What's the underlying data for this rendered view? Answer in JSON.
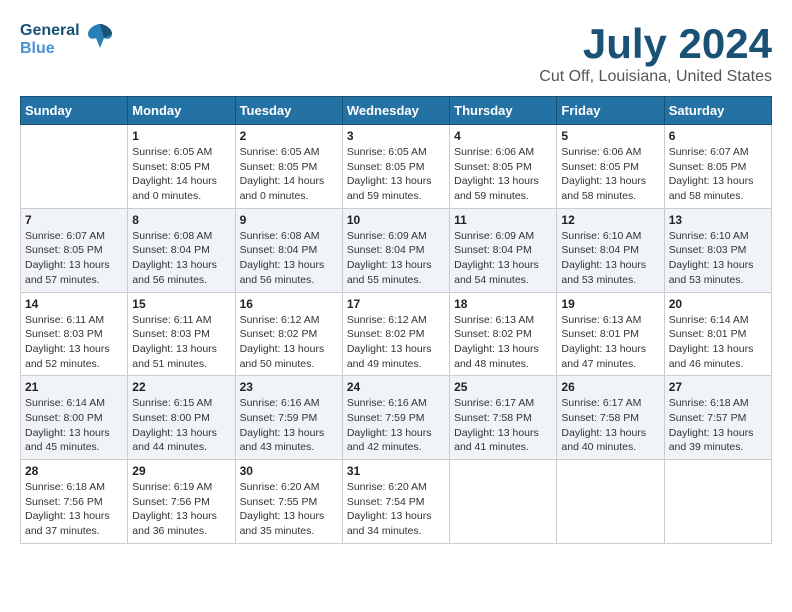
{
  "header": {
    "logo_line1": "General",
    "logo_line2": "Blue",
    "title": "July 2024",
    "location": "Cut Off, Louisiana, United States"
  },
  "weekdays": [
    "Sunday",
    "Monday",
    "Tuesday",
    "Wednesday",
    "Thursday",
    "Friday",
    "Saturday"
  ],
  "weeks": [
    [
      {
        "day": "",
        "info": ""
      },
      {
        "day": "1",
        "info": "Sunrise: 6:05 AM\nSunset: 8:05 PM\nDaylight: 14 hours\nand 0 minutes."
      },
      {
        "day": "2",
        "info": "Sunrise: 6:05 AM\nSunset: 8:05 PM\nDaylight: 14 hours\nand 0 minutes."
      },
      {
        "day": "3",
        "info": "Sunrise: 6:05 AM\nSunset: 8:05 PM\nDaylight: 13 hours\nand 59 minutes."
      },
      {
        "day": "4",
        "info": "Sunrise: 6:06 AM\nSunset: 8:05 PM\nDaylight: 13 hours\nand 59 minutes."
      },
      {
        "day": "5",
        "info": "Sunrise: 6:06 AM\nSunset: 8:05 PM\nDaylight: 13 hours\nand 58 minutes."
      },
      {
        "day": "6",
        "info": "Sunrise: 6:07 AM\nSunset: 8:05 PM\nDaylight: 13 hours\nand 58 minutes."
      }
    ],
    [
      {
        "day": "7",
        "info": "Sunrise: 6:07 AM\nSunset: 8:05 PM\nDaylight: 13 hours\nand 57 minutes."
      },
      {
        "day": "8",
        "info": "Sunrise: 6:08 AM\nSunset: 8:04 PM\nDaylight: 13 hours\nand 56 minutes."
      },
      {
        "day": "9",
        "info": "Sunrise: 6:08 AM\nSunset: 8:04 PM\nDaylight: 13 hours\nand 56 minutes."
      },
      {
        "day": "10",
        "info": "Sunrise: 6:09 AM\nSunset: 8:04 PM\nDaylight: 13 hours\nand 55 minutes."
      },
      {
        "day": "11",
        "info": "Sunrise: 6:09 AM\nSunset: 8:04 PM\nDaylight: 13 hours\nand 54 minutes."
      },
      {
        "day": "12",
        "info": "Sunrise: 6:10 AM\nSunset: 8:04 PM\nDaylight: 13 hours\nand 53 minutes."
      },
      {
        "day": "13",
        "info": "Sunrise: 6:10 AM\nSunset: 8:03 PM\nDaylight: 13 hours\nand 53 minutes."
      }
    ],
    [
      {
        "day": "14",
        "info": "Sunrise: 6:11 AM\nSunset: 8:03 PM\nDaylight: 13 hours\nand 52 minutes."
      },
      {
        "day": "15",
        "info": "Sunrise: 6:11 AM\nSunset: 8:03 PM\nDaylight: 13 hours\nand 51 minutes."
      },
      {
        "day": "16",
        "info": "Sunrise: 6:12 AM\nSunset: 8:02 PM\nDaylight: 13 hours\nand 50 minutes."
      },
      {
        "day": "17",
        "info": "Sunrise: 6:12 AM\nSunset: 8:02 PM\nDaylight: 13 hours\nand 49 minutes."
      },
      {
        "day": "18",
        "info": "Sunrise: 6:13 AM\nSunset: 8:02 PM\nDaylight: 13 hours\nand 48 minutes."
      },
      {
        "day": "19",
        "info": "Sunrise: 6:13 AM\nSunset: 8:01 PM\nDaylight: 13 hours\nand 47 minutes."
      },
      {
        "day": "20",
        "info": "Sunrise: 6:14 AM\nSunset: 8:01 PM\nDaylight: 13 hours\nand 46 minutes."
      }
    ],
    [
      {
        "day": "21",
        "info": "Sunrise: 6:14 AM\nSunset: 8:00 PM\nDaylight: 13 hours\nand 45 minutes."
      },
      {
        "day": "22",
        "info": "Sunrise: 6:15 AM\nSunset: 8:00 PM\nDaylight: 13 hours\nand 44 minutes."
      },
      {
        "day": "23",
        "info": "Sunrise: 6:16 AM\nSunset: 7:59 PM\nDaylight: 13 hours\nand 43 minutes."
      },
      {
        "day": "24",
        "info": "Sunrise: 6:16 AM\nSunset: 7:59 PM\nDaylight: 13 hours\nand 42 minutes."
      },
      {
        "day": "25",
        "info": "Sunrise: 6:17 AM\nSunset: 7:58 PM\nDaylight: 13 hours\nand 41 minutes."
      },
      {
        "day": "26",
        "info": "Sunrise: 6:17 AM\nSunset: 7:58 PM\nDaylight: 13 hours\nand 40 minutes."
      },
      {
        "day": "27",
        "info": "Sunrise: 6:18 AM\nSunset: 7:57 PM\nDaylight: 13 hours\nand 39 minutes."
      }
    ],
    [
      {
        "day": "28",
        "info": "Sunrise: 6:18 AM\nSunset: 7:56 PM\nDaylight: 13 hours\nand 37 minutes."
      },
      {
        "day": "29",
        "info": "Sunrise: 6:19 AM\nSunset: 7:56 PM\nDaylight: 13 hours\nand 36 minutes."
      },
      {
        "day": "30",
        "info": "Sunrise: 6:20 AM\nSunset: 7:55 PM\nDaylight: 13 hours\nand 35 minutes."
      },
      {
        "day": "31",
        "info": "Sunrise: 6:20 AM\nSunset: 7:54 PM\nDaylight: 13 hours\nand 34 minutes."
      },
      {
        "day": "",
        "info": ""
      },
      {
        "day": "",
        "info": ""
      },
      {
        "day": "",
        "info": ""
      }
    ]
  ]
}
